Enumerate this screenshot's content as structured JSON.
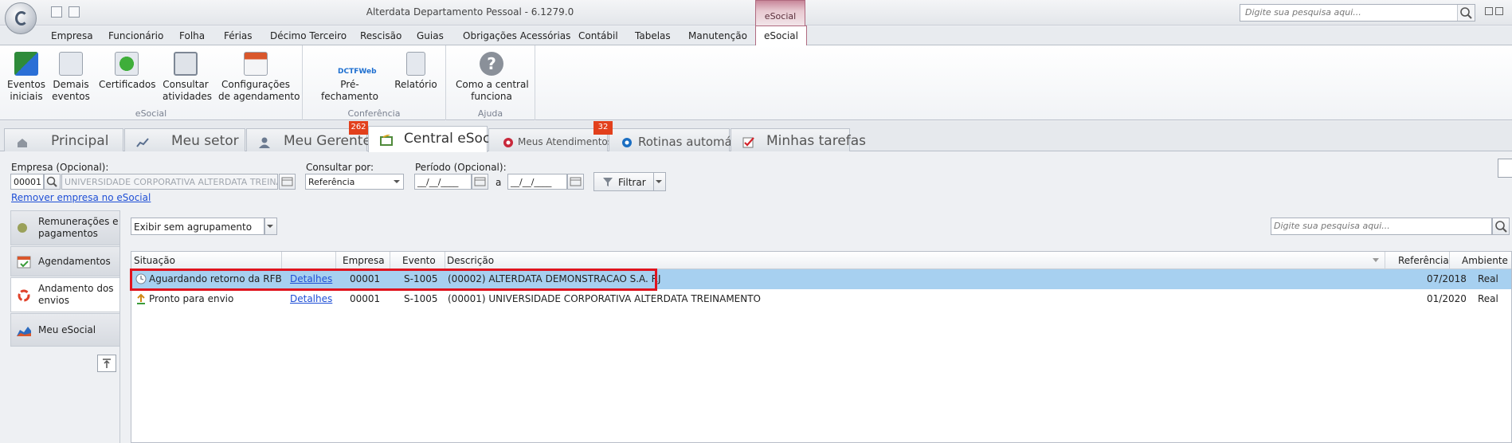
{
  "app": {
    "title": "Alterdata Departamento Pessoal - 6.1279.0",
    "context_tab": "eSocial",
    "search_placeholder": "Digite sua pesquisa aqui..."
  },
  "menu": [
    "Empresa",
    "Funcionário",
    "Folha",
    "Férias",
    "Décimo Terceiro",
    "Rescisão",
    "Guias",
    "Obrigações Acessórias",
    "Contábil",
    "Tabelas",
    "Manutenção",
    "eSocial"
  ],
  "ribbon": {
    "groups": [
      {
        "label": "eSocial",
        "buttons": [
          "Eventos\niniciais",
          "Demais\neventos",
          "Certificados",
          "Consultar\natividades",
          "Configurações\nde agendamento"
        ]
      },
      {
        "label": "Conferência",
        "buttons": [
          "Pré-fechamento",
          "Relatório"
        ]
      },
      {
        "label": "Ajuda",
        "buttons": [
          "Como a central\nfunciona"
        ]
      }
    ],
    "dctfweb_logo": "DCTFWeb"
  },
  "tabs": [
    {
      "label": "Principal",
      "badge": ""
    },
    {
      "label": "Meu setor",
      "badge": ""
    },
    {
      "label": "Meu Gerente",
      "badge": "262"
    },
    {
      "label": "Central eSocial",
      "badge": ""
    },
    {
      "label": "Meus Atendimentos",
      "badge": "32"
    },
    {
      "label": "Rotinas automáticas",
      "badge": ""
    },
    {
      "label": "Minhas tarefas",
      "badge": ""
    }
  ],
  "filters": {
    "empresa_label": "Empresa (Opcional):",
    "empresa_code": "00001",
    "empresa_name": "UNIVERSIDADE CORPORATIVA ALTERDATA TREINAMENTO",
    "consultar_label": "Consultar por:",
    "consultar_value": "Referência",
    "periodo_label": "Período (Opcional):",
    "date_from": "__/__/____",
    "date_sep": "a",
    "date_to": "__/__/____",
    "filtrar": "Filtrar",
    "remove_link": "Remover empresa no eSocial"
  },
  "nav": [
    {
      "label": "Remunerações e\npagamentos"
    },
    {
      "label": "Agendamentos"
    },
    {
      "label": "Andamento dos\nenvios"
    },
    {
      "label": "Meu eSocial"
    }
  ],
  "grouping": {
    "value": "Exibir sem agrupamento",
    "search_placeholder": "Digite sua pesquisa aqui..."
  },
  "grid": {
    "columns": [
      "Situação",
      "",
      "Empresa",
      "Evento",
      "Descrição",
      "Referência",
      "Ambiente"
    ],
    "rows": [
      {
        "situacao": "Aguardando retorno da RFB",
        "detalhes": "Detalhes",
        "empresa": "00001",
        "evento": "S-1005",
        "descricao": "(00002) ALTERDATA DEMONSTRACAO S.A. RJ",
        "referencia": "07/2018",
        "ambiente": "Real"
      },
      {
        "situacao": "Pronto para envio",
        "detalhes": "Detalhes",
        "empresa": "00001",
        "evento": "S-1005",
        "descricao": "(00001) UNIVERSIDADE CORPORATIVA ALTERDATA TREINAMENTO",
        "referencia": "01/2020",
        "ambiente": "Real"
      }
    ]
  },
  "colors": {
    "accent": "#b06a80",
    "selected_row": "#a7d0f0",
    "badge": "#e2401c",
    "highlight": "#e0141e",
    "link": "#1f4fd6"
  }
}
